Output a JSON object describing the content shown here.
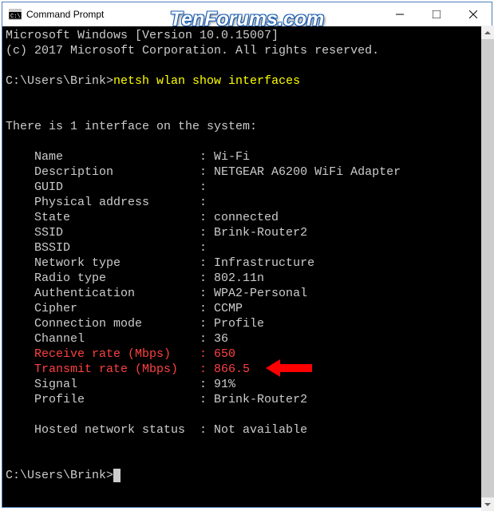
{
  "watermark": "TenForums.com",
  "titlebar": {
    "title": "Command Prompt"
  },
  "terminal": {
    "header1": "Microsoft Windows [Version 10.0.15007]",
    "header2": "(c) 2017 Microsoft Corporation. All rights reserved.",
    "prompt_path": "C:\\Users\\Brink>",
    "command": "netsh wlan show interfaces",
    "intro": "There is 1 interface on the system:",
    "fields": {
      "name_label": "    Name                   : ",
      "name_value": "Wi-Fi",
      "desc_label": "    Description            : ",
      "desc_value": "NETGEAR A6200 WiFi Adapter",
      "guid_label": "    GUID                   :",
      "guid_value": "",
      "phys_label": "    Physical address       :",
      "phys_value": "",
      "state_label": "    State                  : ",
      "state_value": "connected",
      "ssid_label": "    SSID                   : ",
      "ssid_value": "Brink-Router2",
      "bssid_label": "    BSSID                  :",
      "bssid_value": "",
      "nettype_label": "    Network type           : ",
      "nettype_value": "Infrastructure",
      "radio_label": "    Radio type             : ",
      "radio_value": "802.11n",
      "auth_label": "    Authentication         : ",
      "auth_value": "WPA2-Personal",
      "cipher_label": "    Cipher                 : ",
      "cipher_value": "CCMP",
      "connmode_label": "    Connection mode        : ",
      "connmode_value": "Profile",
      "channel_label": "    Channel                : ",
      "channel_value": "36",
      "rxrate_label": "    Receive rate (Mbps)    : ",
      "rxrate_value": "650",
      "txrate_label": "    Transmit rate (Mbps)   : ",
      "txrate_value": "866.5",
      "signal_label": "    Signal                 : ",
      "signal_value": "91%",
      "profile_label": "    Profile                : ",
      "profile_value": "Brink-Router2",
      "hosted_label": "    Hosted network status  : ",
      "hosted_value": "Not available"
    }
  }
}
